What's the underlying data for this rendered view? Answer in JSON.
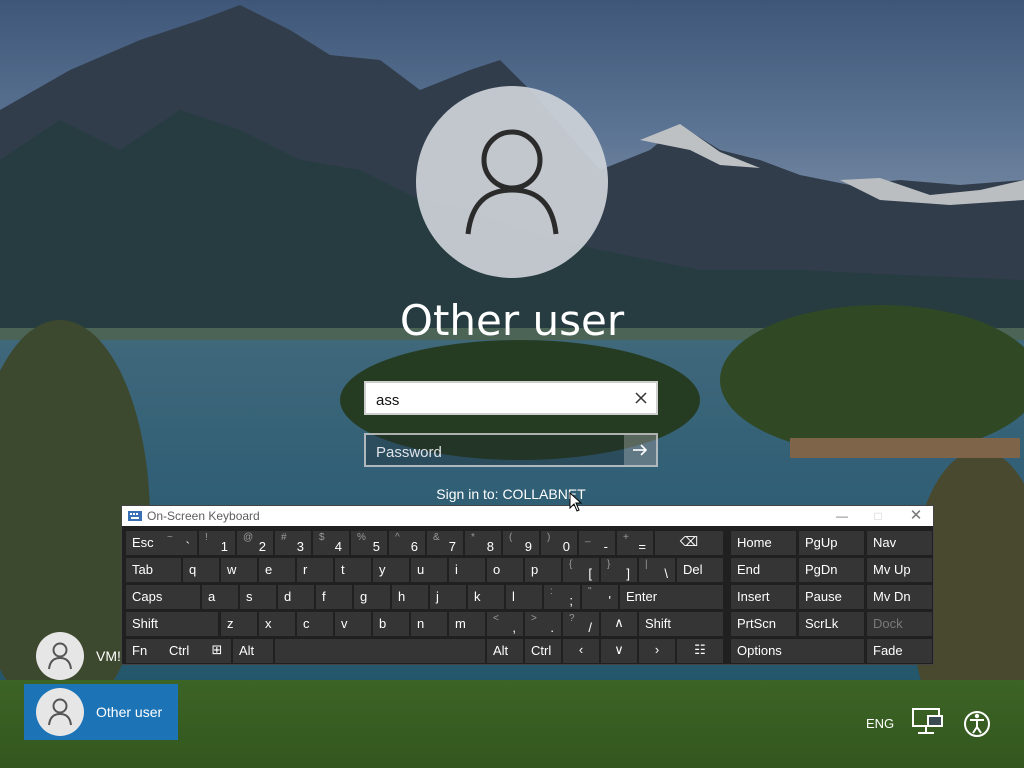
{
  "login": {
    "user_title": "Other user",
    "username_value": "ass",
    "password_placeholder": "Password",
    "sign_in_to": "Sign in to: COLLABNET"
  },
  "users": [
    {
      "label": "VM!",
      "selected": false
    },
    {
      "label": "Other user",
      "selected": true
    }
  ],
  "system": {
    "language": "ENG",
    "network_icon": "network-icon",
    "ease_of_access_icon": "ease-of-access-icon"
  },
  "osk": {
    "title": "On-Screen Keyboard",
    "row1": [
      {
        "main": "Esc"
      },
      {
        "sub": "~",
        "main": "`"
      },
      {
        "sub": "!",
        "main": "1"
      },
      {
        "sub": "@",
        "main": "2"
      },
      {
        "sub": "#",
        "main": "3"
      },
      {
        "sub": "$",
        "main": "4"
      },
      {
        "sub": "%",
        "main": "5"
      },
      {
        "sub": "^",
        "main": "6"
      },
      {
        "sub": "&",
        "main": "7"
      },
      {
        "sub": "*",
        "main": "8"
      },
      {
        "sub": "(",
        "main": "9"
      },
      {
        "sub": ")",
        "main": "0"
      },
      {
        "sub": "_",
        "main": "-"
      },
      {
        "sub": "+",
        "main": "="
      },
      {
        "icon": "backspace-icon"
      }
    ],
    "row2": [
      "Tab",
      "q",
      "w",
      "e",
      "r",
      "t",
      "y",
      "u",
      "i",
      "o",
      "p",
      {
        "sub": "{",
        "main": "["
      },
      {
        "sub": "}",
        "main": "]"
      },
      {
        "sub": "|",
        "main": "\\"
      },
      "Del"
    ],
    "row3": [
      "Caps",
      "a",
      "s",
      "d",
      "f",
      "g",
      "h",
      "j",
      "k",
      "l",
      {
        "sub": ":",
        "main": ";"
      },
      {
        "sub": "\"",
        "main": "'"
      },
      "Enter"
    ],
    "row4": [
      "Shift",
      "z",
      "x",
      "c",
      "v",
      "b",
      "n",
      "m",
      {
        "sub": "<",
        "main": ","
      },
      {
        "sub": ">",
        "main": "."
      },
      {
        "sub": "?",
        "main": "/"
      },
      {
        "icon": "arrow-up-icon"
      },
      "Shift"
    ],
    "row5": [
      "Fn",
      "Ctrl",
      {
        "icon": "windows-icon"
      },
      "Alt",
      "",
      "Alt",
      "Ctrl",
      {
        "icon": "arrow-left-icon"
      },
      {
        "icon": "arrow-down-icon"
      },
      {
        "icon": "arrow-right-icon"
      },
      {
        "icon": "menu-key-icon"
      }
    ],
    "nav": [
      [
        "Home",
        "PgUp",
        "Nav"
      ],
      [
        "End",
        "PgDn",
        "Mv Up"
      ],
      [
        "Insert",
        "Pause",
        "Mv Dn"
      ],
      [
        "PrtScn",
        "ScrLk",
        "Dock"
      ],
      [
        "Options",
        "Fade"
      ]
    ]
  }
}
